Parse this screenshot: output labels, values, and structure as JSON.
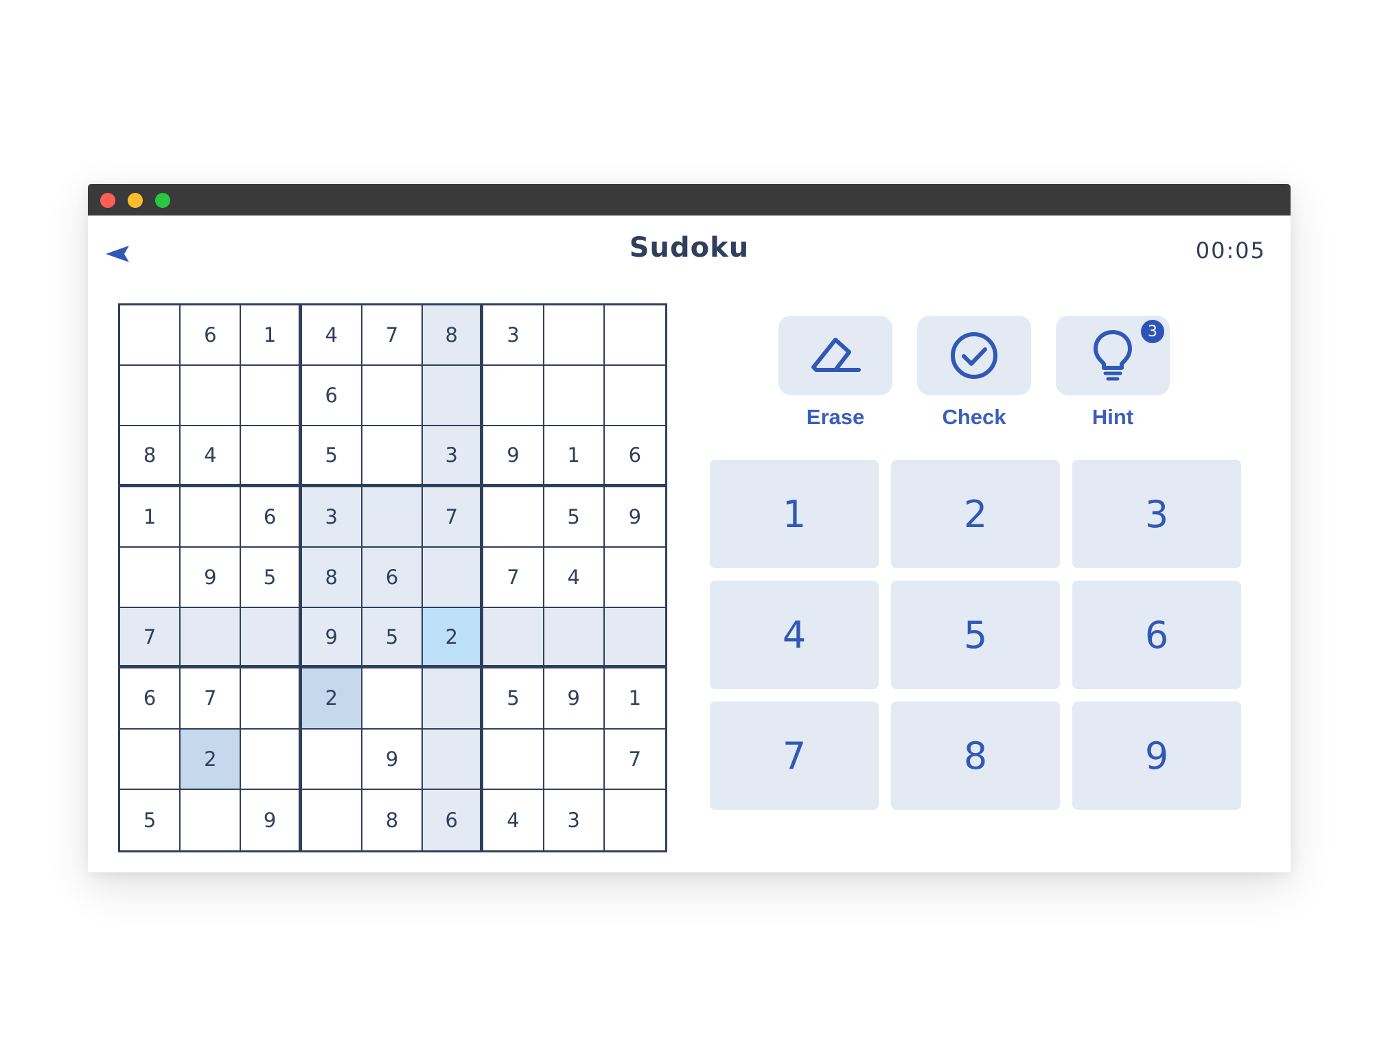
{
  "window": {
    "title": "Sudoku",
    "timer": "00:05"
  },
  "colors": {
    "title_bar": "#3a3a3a",
    "accent": "#3158b6",
    "text": "#2f3f5c",
    "cell_related": "#e3eaf4",
    "cell_same_value": "#c6d8ec",
    "cell_selected": "#bde0f9"
  },
  "board": {
    "selected_cell": {
      "row": 5,
      "col": 5
    },
    "rows": [
      [
        "",
        "6",
        "1",
        "4",
        "7",
        "8",
        "3",
        "",
        ""
      ],
      [
        "",
        "",
        "",
        "6",
        "",
        "",
        "",
        "",
        ""
      ],
      [
        "8",
        "4",
        "",
        "5",
        "",
        "3",
        "9",
        "1",
        "6"
      ],
      [
        "1",
        "",
        "6",
        "3",
        "",
        "7",
        "",
        "5",
        "9"
      ],
      [
        "",
        "9",
        "5",
        "8",
        "6",
        "",
        "7",
        "4",
        ""
      ],
      [
        "7",
        "",
        "",
        "9",
        "5",
        "2",
        "",
        "",
        ""
      ],
      [
        "6",
        "7",
        "",
        "2",
        "",
        "",
        "5",
        "9",
        "1"
      ],
      [
        "",
        "2",
        "",
        "",
        "9",
        "",
        "",
        "",
        "7"
      ],
      [
        "5",
        "",
        "9",
        "",
        "8",
        "6",
        "4",
        "3",
        ""
      ]
    ]
  },
  "tools": [
    {
      "id": "erase",
      "label": "Erase",
      "icon": "eraser-icon"
    },
    {
      "id": "check",
      "label": "Check",
      "icon": "check-circle-icon"
    },
    {
      "id": "hint",
      "label": "Hint",
      "icon": "lightbulb-icon",
      "badge": "3"
    }
  ],
  "numpad": [
    "1",
    "2",
    "3",
    "4",
    "5",
    "6",
    "7",
    "8",
    "9"
  ]
}
